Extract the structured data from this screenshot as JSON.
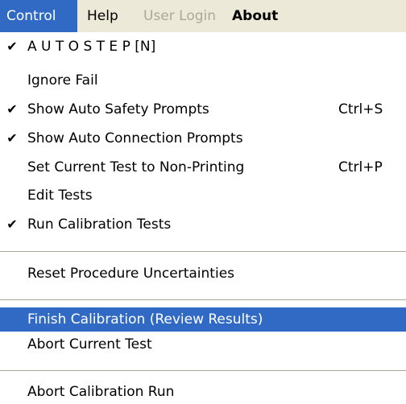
{
  "menubar": {
    "control": "Control",
    "help": "Help",
    "user_login": "User Login",
    "about": "About"
  },
  "menu": {
    "autostep": {
      "label": "A U T O S T E P [N]",
      "checked": true,
      "check": "✔"
    },
    "ignore_fail": {
      "label": "Ignore Fail",
      "checked": false
    },
    "safety_prompts": {
      "label": "Show Auto Safety Prompts",
      "checked": true,
      "check": "✔",
      "shortcut": "Ctrl+S"
    },
    "connection_prompts": {
      "label": "Show Auto Connection Prompts",
      "checked": true,
      "check": "✔"
    },
    "non_printing": {
      "label": "Set Current Test to Non-Printing",
      "checked": false,
      "shortcut": "Ctrl+P"
    },
    "edit_tests": {
      "label": "Edit Tests",
      "checked": false
    },
    "run_calibration": {
      "label": "Run Calibration Tests",
      "checked": true,
      "check": "✔"
    },
    "reset_uncertainties": {
      "label": "Reset Procedure Uncertainties",
      "checked": false
    },
    "finish_calibration": {
      "label": "Finish Calibration (Review Results)",
      "checked": false,
      "highlighted": true
    },
    "abort_test": {
      "label": "Abort Current Test",
      "checked": false
    },
    "abort_run": {
      "label": "Abort Calibration Run",
      "checked": false
    }
  },
  "colors": {
    "menubar_bg": "#ece9d8",
    "highlight": "#316ac5",
    "disabled": "#aca899"
  }
}
